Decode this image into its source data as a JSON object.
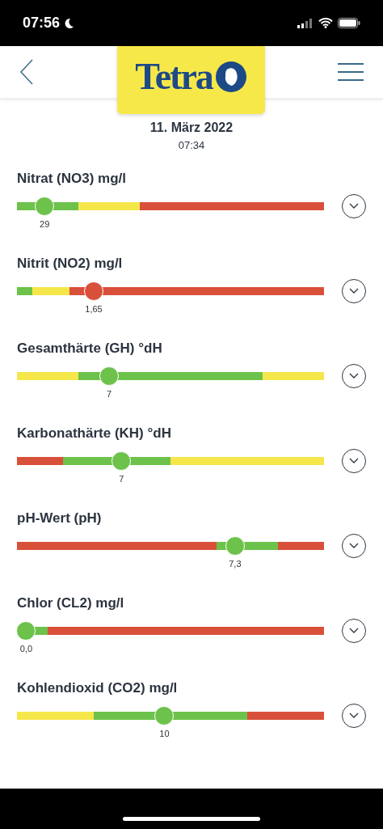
{
  "status_bar": {
    "time": "07:56"
  },
  "header": {
    "logo": "Tetra"
  },
  "date": "11. März 2022",
  "time": "07:34",
  "parameters": [
    {
      "name": "Nitrat (NO3) mg/l",
      "reading": "29",
      "level": 0.09,
      "expanded": false,
      "track": {
        "color": "#d9503a"
      },
      "zones": [
        {
          "color": "#6cc24a",
          "level": 0.2
        },
        {
          "color": "#f5e74a",
          "level": 0.4
        }
      ]
    },
    {
      "name": "Nitrit (NO2) mg/l",
      "reading": "1,65",
      "level": 0.25,
      "expanded": false,
      "track": {
        "color": "#d9503a"
      },
      "zones": [
        {
          "color": "#6cc24a",
          "level": 0.05
        },
        {
          "color": "#f5e74a",
          "level": 0.17
        }
      ]
    },
    {
      "name": "Gesamthärte (GH) °dH",
      "reading": "7",
      "level": 0.3,
      "expanded": false,
      "track": {
        "color": "#f5e74a"
      },
      "zones": [
        {
          "color": "#f5e74a",
          "level": 0.2
        },
        {
          "color": "#6cc24a",
          "level": 0.8
        }
      ]
    },
    {
      "name": "Karbonathärte (KH) °dH",
      "reading": "7",
      "level": 0.34,
      "expanded": false,
      "track": {
        "color": "#f5e74a"
      },
      "zones": [
        {
          "color": "#d9503a",
          "level": 0.15
        },
        {
          "color": "#6cc24a",
          "level": 0.5
        }
      ]
    },
    {
      "name": "pH-Wert (pH)",
      "reading": "7,3",
      "level": 0.71,
      "expanded": false,
      "track": {
        "color": "#d9503a"
      },
      "zones": [
        {
          "color": "#d9503a",
          "level": 0.65
        },
        {
          "color": "#6cc24a",
          "level": 0.85
        }
      ]
    },
    {
      "name": "Chlor (CL2) mg/l",
      "reading": "0,0",
      "level": 0.03,
      "expanded": false,
      "track": {
        "color": "#d9503a"
      },
      "zones": [
        {
          "color": "#6cc24a",
          "level": 0.1
        }
      ]
    },
    {
      "name": "Kohlendioxid (CO2) mg/l",
      "reading": "10",
      "level": 0.48,
      "expanded": false,
      "track": {
        "color": "#d9503a"
      },
      "zones": [
        {
          "color": "#f5e74a",
          "level": 0.25
        },
        {
          "color": "#6cc24a",
          "level": 0.75
        }
      ]
    }
  ]
}
